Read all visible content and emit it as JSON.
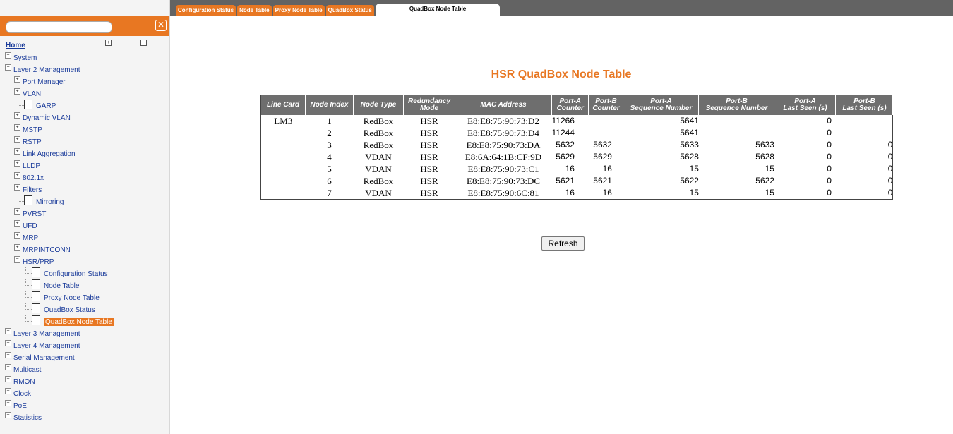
{
  "tabs": [
    "Configuration Status",
    "Node Table",
    "Proxy Node Table",
    "QuadBox Status",
    "QuadBox Node Table"
  ],
  "sidebar": {
    "search_placeholder": "",
    "close_glyph": "✕",
    "home": "Home",
    "expand_glyph": "+",
    "collapse_glyph": "−",
    "tree": [
      {
        "label": "System",
        "level": 0,
        "type": "plus"
      },
      {
        "label": "Layer 2 Management",
        "level": 0,
        "type": "minus"
      },
      {
        "label": "Port Manager",
        "level": 1,
        "type": "plus"
      },
      {
        "label": "VLAN",
        "level": 1,
        "type": "plus"
      },
      {
        "label": "GARP",
        "level": 2,
        "type": "doc"
      },
      {
        "label": "Dynamic VLAN",
        "level": 1,
        "type": "plus"
      },
      {
        "label": "MSTP",
        "level": 1,
        "type": "plus"
      },
      {
        "label": "RSTP",
        "level": 1,
        "type": "plus"
      },
      {
        "label": "Link Aggregation",
        "level": 1,
        "type": "plus"
      },
      {
        "label": "LLDP",
        "level": 1,
        "type": "plus"
      },
      {
        "label": "802.1x",
        "level": 1,
        "type": "plus"
      },
      {
        "label": "Filters",
        "level": 1,
        "type": "plus"
      },
      {
        "label": "Mirroring",
        "level": 2,
        "type": "doc"
      },
      {
        "label": "PVRST",
        "level": 1,
        "type": "plus"
      },
      {
        "label": "UFD",
        "level": 1,
        "type": "plus"
      },
      {
        "label": "MRP",
        "level": 1,
        "type": "plus"
      },
      {
        "label": "MRPINTCONN",
        "level": 1,
        "type": "plus"
      },
      {
        "label": "HSR/PRP",
        "level": 1,
        "type": "minus"
      },
      {
        "label": "Configuration Status",
        "level": 3,
        "type": "doc"
      },
      {
        "label": "Node Table",
        "level": 3,
        "type": "doc"
      },
      {
        "label": "Proxy Node Table",
        "level": 3,
        "type": "doc"
      },
      {
        "label": "QuadBox Status",
        "level": 3,
        "type": "doc"
      },
      {
        "label": "QuadBox Node Table",
        "level": 3,
        "type": "doc",
        "selected": true
      },
      {
        "label": "Layer 3 Management",
        "level": 0,
        "type": "plus"
      },
      {
        "label": "Layer 4 Management",
        "level": 0,
        "type": "plus"
      },
      {
        "label": "Serial Management",
        "level": 0,
        "type": "plus"
      },
      {
        "label": "Multicast",
        "level": 0,
        "type": "plus"
      },
      {
        "label": "RMON",
        "level": 0,
        "type": "plus"
      },
      {
        "label": "Clock",
        "level": 0,
        "type": "plus"
      },
      {
        "label": "PoE",
        "level": 0,
        "type": "plus"
      },
      {
        "label": "Statistics",
        "level": 0,
        "type": "plus"
      }
    ]
  },
  "main": {
    "title": "HSR QuadBox Node Table",
    "columns": [
      [
        "Line Card"
      ],
      [
        "Node Index"
      ],
      [
        "Node Type"
      ],
      [
        "Redundancy",
        "Mode"
      ],
      [
        "MAC Address"
      ],
      [
        "Port-A",
        "Counter"
      ],
      [
        "Port-B",
        "Counter"
      ],
      [
        "Port-A",
        "Sequence Number"
      ],
      [
        "Port-B",
        "Sequence Number"
      ],
      [
        "Port-A",
        "Last Seen (s)"
      ],
      [
        "Port-B",
        "Last Seen (s)"
      ]
    ],
    "rows": [
      [
        "LM3",
        "1",
        "RedBox",
        "HSR",
        "E8:E8:75:90:73:D2",
        "11266",
        "",
        "5641",
        "",
        "0",
        ""
      ],
      [
        "",
        "2",
        "RedBox",
        "HSR",
        "E8:E8:75:90:73:D4",
        "11244",
        "",
        "5641",
        "",
        "0",
        ""
      ],
      [
        "",
        "3",
        "RedBox",
        "HSR",
        "E8:E8:75:90:73:DA",
        "5632",
        "5632",
        "5633",
        "5633",
        "0",
        "0"
      ],
      [
        "",
        "4",
        "VDAN",
        "HSR",
        "E8:6A:64:1B:CF:9D",
        "5629",
        "5629",
        "5628",
        "5628",
        "0",
        "0"
      ],
      [
        "",
        "5",
        "VDAN",
        "HSR",
        "E8:E8:75:90:73:C1",
        "16",
        "16",
        "15",
        "15",
        "0",
        "0"
      ],
      [
        "",
        "6",
        "RedBox",
        "HSR",
        "E8:E8:75:90:73:DC",
        "5621",
        "5621",
        "5622",
        "5622",
        "0",
        "0"
      ],
      [
        "",
        "7",
        "VDAN",
        "HSR",
        "E8:E8:75:90:6C:81",
        "16",
        "16",
        "15",
        "15",
        "0",
        "0"
      ]
    ],
    "refresh": "Refresh"
  },
  "colors": {
    "accent": "#e87722",
    "topbar": "#636363",
    "header": "#6e6e6e",
    "link": "#1a3b9a"
  }
}
